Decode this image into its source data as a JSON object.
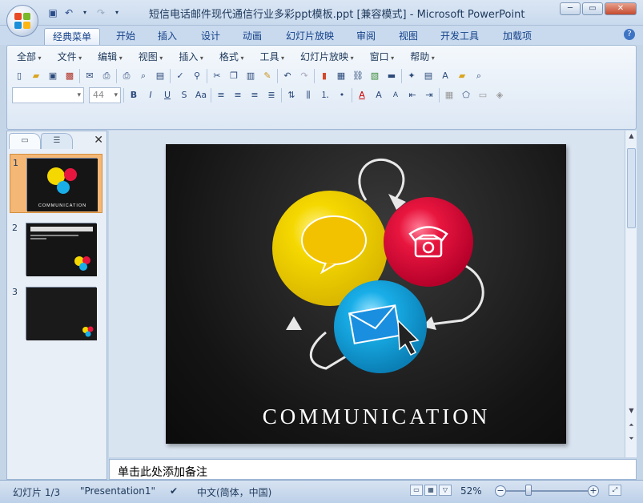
{
  "window": {
    "title": "短信电话邮件现代通信行业多彩ppt模板.ppt [兼容模式] - Microsoft PowerPoint"
  },
  "qat": {
    "icons": [
      "save-icon",
      "undo-icon",
      "redo-icon",
      "customize-icon"
    ]
  },
  "tabs": [
    "经典菜单",
    "开始",
    "插入",
    "设计",
    "动画",
    "幻灯片放映",
    "审阅",
    "视图",
    "开发工具",
    "加载项"
  ],
  "menus": [
    "全部",
    "文件",
    "编辑",
    "视图",
    "插入",
    "格式",
    "工具",
    "幻灯片放映",
    "窗口",
    "帮助"
  ],
  "toolbar": {
    "font_size": "44"
  },
  "slides": [
    {
      "num": "1"
    },
    {
      "num": "2"
    },
    {
      "num": "3"
    }
  ],
  "slide": {
    "caption": "COMMUNICATION"
  },
  "notes": {
    "placeholder": "单击此处添加备注"
  },
  "status": {
    "slide_counter": "幻灯片 1/3",
    "theme": "\"Presentation1\"",
    "language": "中文(简体，中国)",
    "zoom": "52%"
  },
  "colors": {
    "yellow": "#f5d800",
    "red": "#e8163f",
    "blue": "#19aee8",
    "selected_thumb": "#f4b776"
  }
}
